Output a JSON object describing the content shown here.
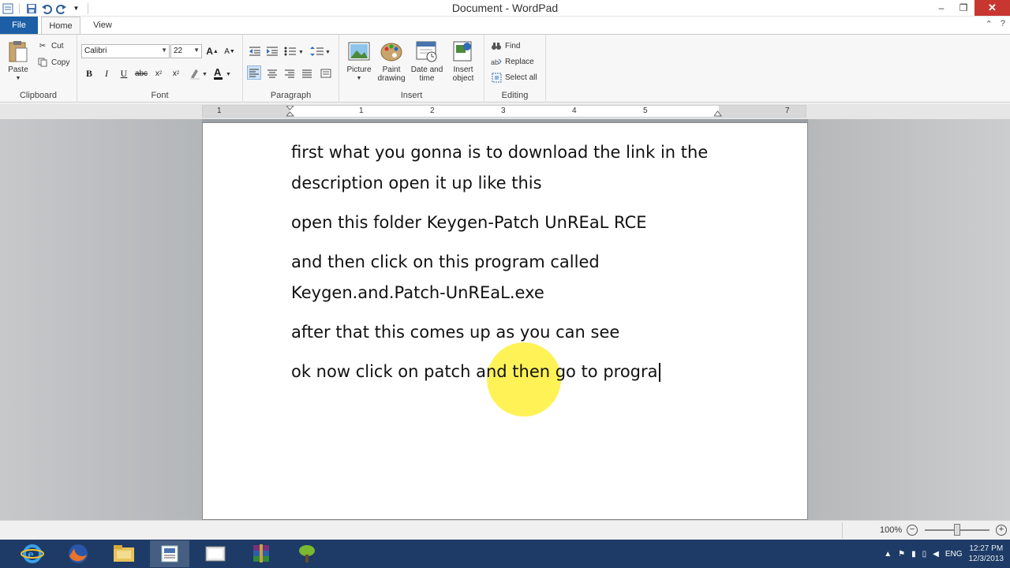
{
  "window": {
    "title": "Document - WordPad"
  },
  "tabs": {
    "file": "File",
    "home": "Home",
    "view": "View"
  },
  "clipboard": {
    "paste": "Paste",
    "cut": "Cut",
    "copy": "Copy",
    "label": "Clipboard"
  },
  "font": {
    "family": "Calibri",
    "size": "22",
    "label": "Font"
  },
  "paragraph": {
    "label": "Paragraph"
  },
  "insert": {
    "picture": "Picture",
    "paint_1": "Paint",
    "paint_2": "drawing",
    "datetime_1": "Date and",
    "datetime_2": "time",
    "object_1": "Insert",
    "object_2": "object",
    "label": "Insert"
  },
  "editing": {
    "find": "Find",
    "replace": "Replace",
    "select_all": "Select all",
    "label": "Editing"
  },
  "ruler": {
    "numbers": [
      "1",
      "1",
      "2",
      "3",
      "4",
      "5",
      "7"
    ]
  },
  "document": {
    "paragraphs": [
      "first what you gonna is to download the link in the description open it up like this",
      "open this folder Keygen-Patch UnREaL RCE",
      "and then click on this program called Keygen.and.Patch-UnREaL.exe",
      "after that this comes up as you can see",
      "ok now click on patch and then go to progra"
    ]
  },
  "status": {
    "zoom": "100%"
  },
  "tray": {
    "lang": "ENG",
    "time": "12:27 PM",
    "date": "12/3/2013"
  },
  "colors": {
    "file_tab": "#1c5fa6",
    "close_button": "#c7372f",
    "taskbar": "#1d3b66",
    "highlight": "#ffee28"
  }
}
